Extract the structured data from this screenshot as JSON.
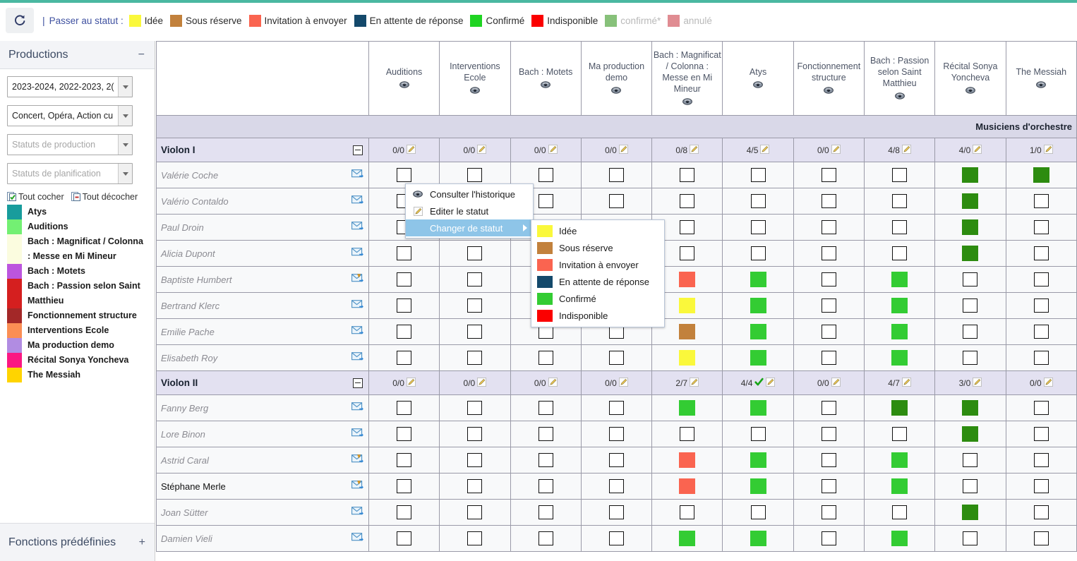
{
  "toolbar": {
    "refresh_icon": "refresh-icon",
    "separator": "|",
    "label": "Passer au statut :",
    "legend": [
      {
        "text": "Idée",
        "color": "#FAF83B",
        "muted": false
      },
      {
        "text": "Sous réserve",
        "color": "#C2813C",
        "muted": false
      },
      {
        "text": "Invitation à envoyer",
        "color": "#FA6450",
        "muted": false
      },
      {
        "text": "En attente de réponse",
        "color": "#14496B",
        "muted": false
      },
      {
        "text": "Confirmé",
        "color": "#1FD422",
        "muted": false
      },
      {
        "text": "Indisponible",
        "color": "#FB0000",
        "muted": false
      },
      {
        "text": "confirmé*",
        "color": "#87C17A",
        "muted": true
      },
      {
        "text": "annulé",
        "color": "#E08C92",
        "muted": true
      }
    ]
  },
  "sidebar": {
    "panel_title": "Productions",
    "panel_toggle": "−",
    "filters": [
      {
        "name": "seasons-select",
        "value": "2023-2024, 2022-2023, 2(",
        "placeholder": false
      },
      {
        "name": "types-select",
        "value": "Concert, Opéra, Action cu",
        "placeholder": false
      },
      {
        "name": "production-status-select",
        "value": "Statuts de production",
        "placeholder": true
      },
      {
        "name": "planning-status-select",
        "value": "Statuts de planification",
        "placeholder": true
      }
    ],
    "check_all": "Tout cocher",
    "uncheck_all": "Tout décocher",
    "productions": [
      {
        "label": "Atys",
        "color": "#189C9C"
      },
      {
        "label": "Auditions",
        "color": "#73F073"
      },
      {
        "label": "Bach : Magnificat / Colonna : Messe en Mi Mineur",
        "color": "#FBFCDF"
      },
      {
        "label": "Bach : Motets",
        "color": "#BC55DE"
      },
      {
        "label": "Bach : Passion selon Saint Matthieu",
        "color": "#D51F1F"
      },
      {
        "label": "Fonctionnement structure",
        "color": "#A32828"
      },
      {
        "label": "Interventions Ecole",
        "color": "#FB8E54"
      },
      {
        "label": "Ma production demo",
        "color": "#B18CE2"
      },
      {
        "label": "Récital Sonya Yoncheva",
        "color": "#FB1782"
      },
      {
        "label": "The Messiah",
        "color": "#FFD400"
      }
    ],
    "bottom_panel_title": "Fonctions prédéfinies",
    "bottom_panel_toggle": "+"
  },
  "grid": {
    "columns": [
      "Auditions",
      "Interventions Ecole",
      "Bach : Motets",
      "Ma production demo",
      "Bach : Magnificat / Colonna : Messe en Mi Mineur",
      "Atys",
      "Fonctionnement structure",
      "Bach : Passion selon Saint Matthieu",
      "Récital Sonya Yoncheva",
      "The Messiah"
    ],
    "group_header": "Musiciens d'orchestre",
    "colors": {
      "idee": "#FAF83B",
      "sous_reserve": "#C2813C",
      "invitation": "#FA6450",
      "attente": "#14496B",
      "confirme": "#33CC33",
      "confirme_dark": "#2D8C10",
      "indisponible": "#FB0000"
    },
    "sections": [
      {
        "name": "Violon I",
        "counts": [
          "0/0",
          "0/0",
          "0/0",
          "0/0",
          "0/8",
          "4/5",
          "0/0",
          "4/8",
          "4/0",
          "1/0"
        ],
        "count_check": [
          false,
          false,
          false,
          false,
          false,
          false,
          false,
          false,
          false,
          false
        ],
        "people": [
          {
            "name": "Valérie Coche",
            "bold": false,
            "mail": "mail",
            "cells": [
              "",
              "",
              "",
              "",
              "",
              "",
              "",
              "",
              "confirme_dark",
              "confirme_dark"
            ]
          },
          {
            "name": "Valério Contaldo",
            "bold": false,
            "mail": "mail",
            "cells": [
              "",
              "",
              "",
              "",
              "",
              "",
              "",
              "",
              "confirme_dark",
              ""
            ]
          },
          {
            "name": "Paul Droin",
            "bold": false,
            "mail": "mail",
            "cells": [
              "",
              "",
              "",
              "",
              "",
              "",
              "",
              "",
              "confirme_dark",
              ""
            ]
          },
          {
            "name": "Alicia Dupont",
            "bold": false,
            "mail": "mail",
            "cells": [
              "",
              "",
              "",
              "",
              "",
              "",
              "",
              "",
              "confirme_dark",
              ""
            ]
          },
          {
            "name": "Baptiste Humbert",
            "bold": false,
            "mail": "mail-alert",
            "cells": [
              "",
              "",
              "",
              "",
              "invitation",
              "confirme",
              "",
              "confirme",
              "",
              ""
            ]
          },
          {
            "name": "Bertrand Klerc",
            "bold": false,
            "mail": "mail",
            "cells": [
              "",
              "",
              "",
              "",
              "idee",
              "confirme",
              "",
              "confirme",
              "",
              ""
            ]
          },
          {
            "name": "Emilie Pache",
            "bold": false,
            "mail": "mail",
            "cells": [
              "",
              "",
              "",
              "",
              "sous_reserve",
              "confirme",
              "",
              "confirme",
              "",
              ""
            ]
          },
          {
            "name": "Elisabeth Roy",
            "bold": false,
            "mail": "mail",
            "cells": [
              "",
              "",
              "",
              "",
              "idee",
              "confirme",
              "",
              "confirme",
              "",
              ""
            ]
          }
        ]
      },
      {
        "name": "Violon II",
        "counts": [
          "0/0",
          "0/0",
          "0/0",
          "0/0",
          "2/7",
          "4/4",
          "0/0",
          "4/7",
          "3/0",
          "0/0"
        ],
        "count_check": [
          false,
          false,
          false,
          false,
          false,
          true,
          false,
          false,
          false,
          false
        ],
        "people": [
          {
            "name": "Fanny Berg",
            "bold": false,
            "mail": "mail",
            "cells": [
              "",
              "",
              "",
              "",
              "confirme",
              "confirme",
              "",
              "confirme_dark",
              "confirme_dark",
              ""
            ]
          },
          {
            "name": "Lore Binon",
            "bold": false,
            "mail": "mail",
            "cells": [
              "",
              "",
              "",
              "",
              "",
              "",
              "",
              "",
              "confirme_dark",
              ""
            ]
          },
          {
            "name": "Astrid Caral",
            "bold": false,
            "mail": "mail-alert",
            "cells": [
              "",
              "",
              "",
              "",
              "invitation",
              "confirme",
              "",
              "confirme",
              "",
              ""
            ]
          },
          {
            "name": "Stéphane Merle",
            "bold": true,
            "mail": "mail-alert",
            "cells": [
              "",
              "",
              "",
              "",
              "invitation",
              "confirme",
              "",
              "confirme",
              "",
              ""
            ]
          },
          {
            "name": "Joan Sütter",
            "bold": false,
            "mail": "mail",
            "cells": [
              "",
              "",
              "",
              "",
              "",
              "",
              "",
              "",
              "confirme_dark",
              ""
            ]
          },
          {
            "name": "Damien Vieli",
            "bold": false,
            "mail": "mail",
            "cells": [
              "",
              "",
              "",
              "",
              "confirme",
              "confirme",
              "",
              "confirme",
              "",
              ""
            ]
          }
        ]
      }
    ]
  },
  "context_menu": {
    "items": [
      {
        "label": "Consulter l'historique",
        "icon": "eye-icon",
        "selected": false,
        "submenu": false
      },
      {
        "label": "Editer le statut",
        "icon": "pencil-icon",
        "selected": false,
        "submenu": false
      },
      {
        "label": "Changer de statut",
        "icon": "",
        "selected": true,
        "submenu": true
      }
    ],
    "submenu": [
      {
        "label": "Idée",
        "color": "#FAF83B"
      },
      {
        "label": "Sous réserve",
        "color": "#C2813C"
      },
      {
        "label": "Invitation à envoyer",
        "color": "#FA6450"
      },
      {
        "label": "En attente de réponse",
        "color": "#14496B"
      },
      {
        "label": "Confirmé",
        "color": "#33CC33"
      },
      {
        "label": "Indisponible",
        "color": "#FB0000"
      }
    ]
  }
}
